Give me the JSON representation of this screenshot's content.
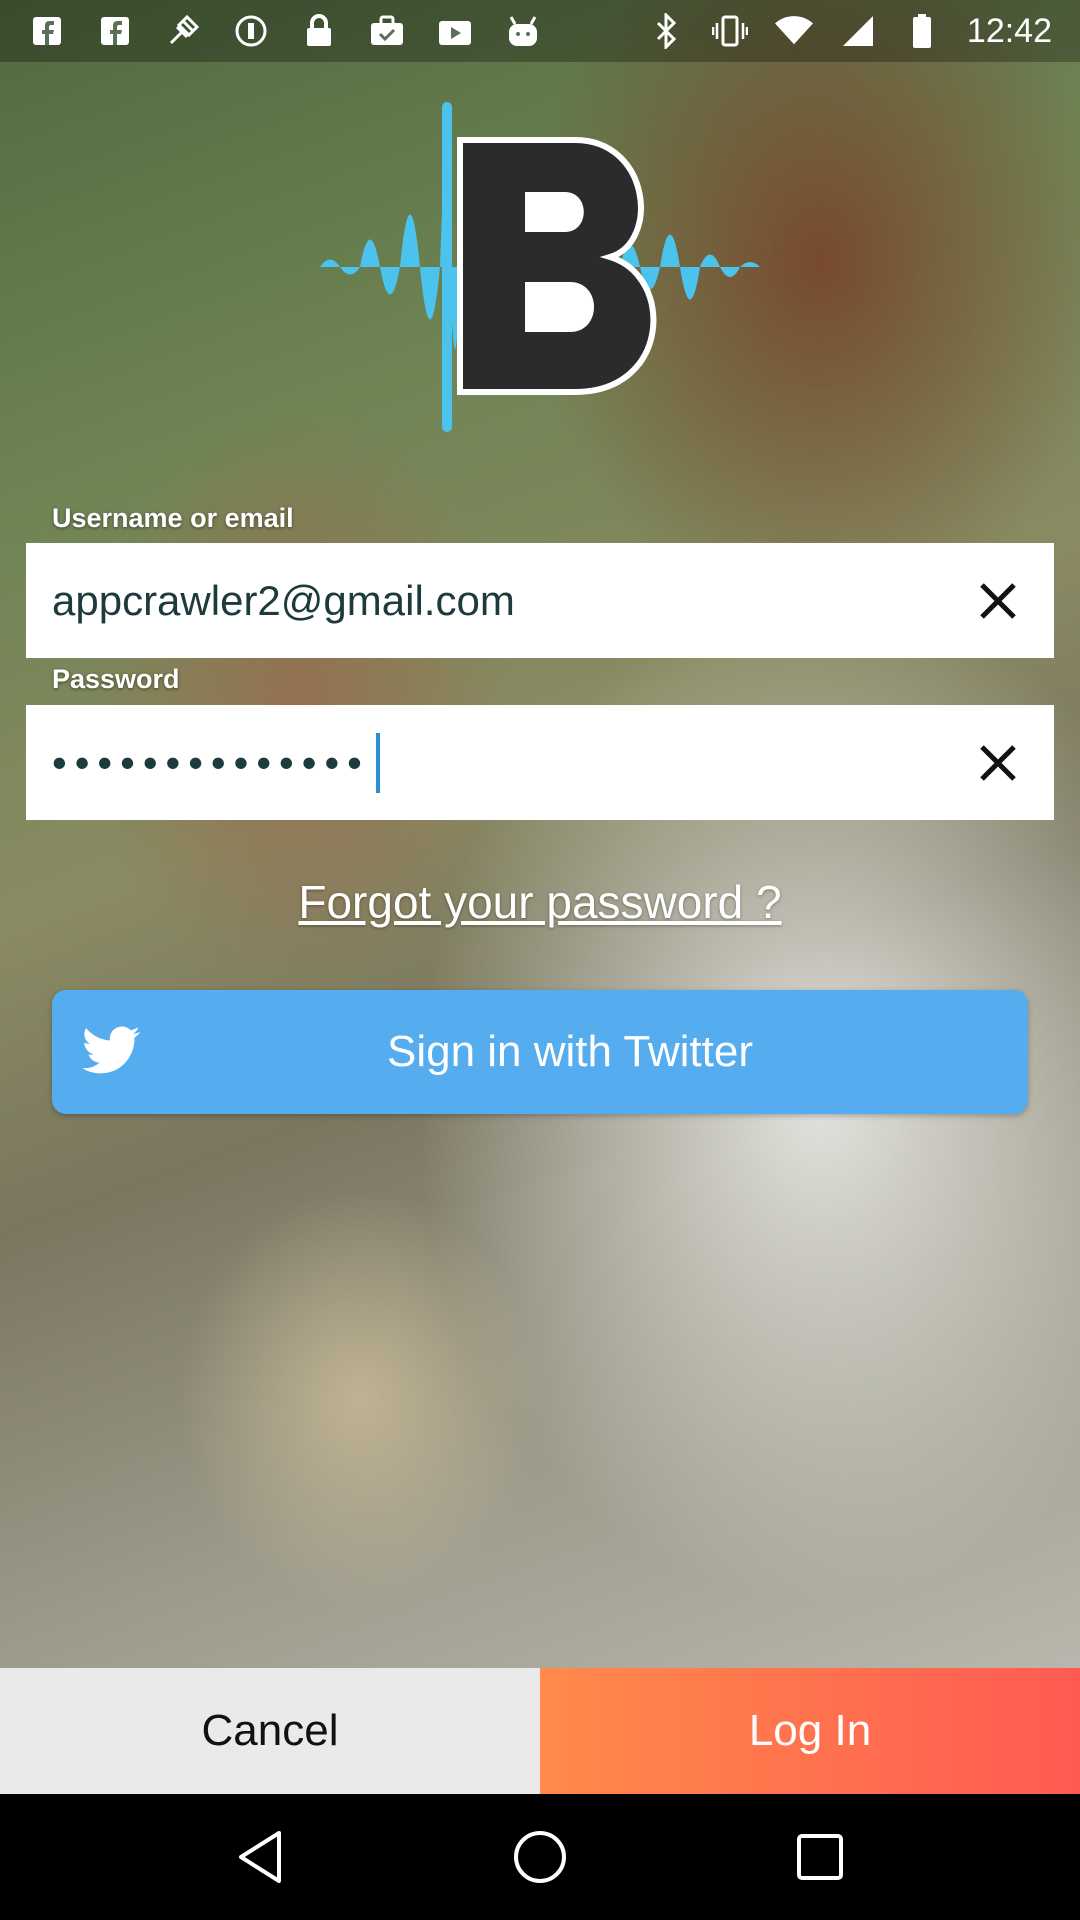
{
  "status_bar": {
    "time": "12:42",
    "icons": [
      "facebook-icon",
      "facebook-icon",
      "fake-gps-icon",
      "info-icon",
      "lock-icon",
      "briefcase-check-icon",
      "play-store-icon",
      "android-icon",
      "bluetooth-icon",
      "vibrate-icon",
      "wifi-icon",
      "signal-icon",
      "battery-icon"
    ]
  },
  "logo": {
    "letter": "B"
  },
  "form": {
    "username_label": "Username or email",
    "username_value": "appcrawler2@gmail.com",
    "password_label": "Password",
    "password_dots": "••••••••••••••",
    "forgot_password": "Forgot your password ?"
  },
  "twitter": {
    "label": "Sign in with Twitter"
  },
  "actions": {
    "cancel": "Cancel",
    "login": "Log In"
  },
  "colors": {
    "twitter": "#55acee",
    "login_gradient_start": "#ff8a4a",
    "login_gradient_end": "#ff5a52",
    "cancel_bg": "#eaeaea",
    "logo_wave": "#4cc3ec",
    "logo_letter": "#2b2b2d"
  }
}
